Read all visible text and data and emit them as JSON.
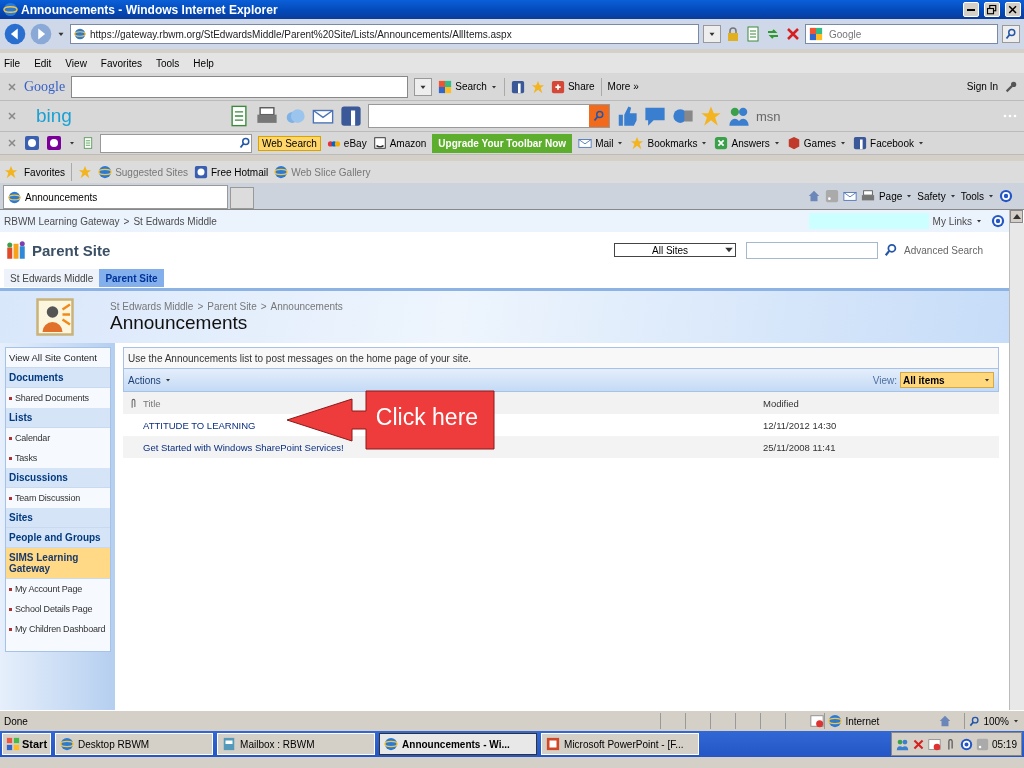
{
  "window": {
    "title": "Announcements - Windows Internet Explorer"
  },
  "address_bar": {
    "url": "https://gateway.rbwm.org/StEdwardsMiddle/Parent%20Site/Lists/Announcements/AllItems.aspx"
  },
  "search_box": {
    "placeholder": "Google"
  },
  "menu_bar": [
    "File",
    "Edit",
    "View",
    "Favorites",
    "Tools",
    "Help"
  ],
  "google_toolbar": {
    "logo": "Google",
    "search_label": "Search",
    "share_label": "Share",
    "more_label": "More »",
    "sign_in": "Sign In"
  },
  "bing_toolbar": {
    "logo": "bing",
    "msn_label": "msn"
  },
  "yahoo_toolbar": {
    "web_search": "Web Search",
    "links": [
      "eBay",
      "Amazon"
    ],
    "upgrade_button": "Upgrade Your Toolbar Now",
    "menus": [
      "Mail",
      "Bookmarks",
      "Answers",
      "Games",
      "Facebook"
    ]
  },
  "favorites_bar": {
    "label": "Favorites",
    "items": [
      "Suggested Sites",
      "Free Hotmail",
      "Web Slice Gallery"
    ]
  },
  "tabs": [
    {
      "label": "Announcements",
      "selected": true
    }
  ],
  "command_bar": [
    "Page",
    "Safety",
    "Tools"
  ],
  "page": {
    "top_breadcrumb": [
      "RBWM Learning Gateway",
      "St Edwards Middle"
    ],
    "breadcrumb_separator": ">",
    "my_links": "My Links",
    "site_title": "Parent Site",
    "search_scope": "All Sites",
    "advanced_search": "Advanced Search",
    "site_tabs": [
      {
        "label": "St Edwards Middle",
        "selected": false
      },
      {
        "label": "Parent Site",
        "selected": true
      }
    ],
    "breadcrumb": [
      "St Edwards Middle",
      "Parent Site",
      "Announcements"
    ],
    "heading": "Announcements",
    "description": "Use the Announcements list to post messages on the home page of your site.",
    "actions": "Actions",
    "view_label": "View:",
    "view": "All items",
    "columns": [
      "Title",
      "Modified"
    ],
    "rows": [
      {
        "title": "ATTITUDE TO LEARNING",
        "modified": "12/11/2012 14:30"
      },
      {
        "title": "Get Started with Windows SharePoint Services!",
        "modified": "25/11/2008 11:41"
      }
    ],
    "sidebar": [
      {
        "kind": "link",
        "label": "View All Site Content",
        "selected": false
      },
      {
        "kind": "heading",
        "label": "Documents",
        "selected": false
      },
      {
        "kind": "item",
        "label": "Shared Documents",
        "selected": false
      },
      {
        "kind": "heading",
        "label": "Lists",
        "selected": false
      },
      {
        "kind": "item",
        "label": "Calendar",
        "selected": false
      },
      {
        "kind": "item",
        "label": "Tasks",
        "selected": false
      },
      {
        "kind": "heading",
        "label": "Discussions",
        "selected": false
      },
      {
        "kind": "item",
        "label": "Team Discussion",
        "selected": false
      },
      {
        "kind": "heading",
        "label": "Sites",
        "selected": false
      },
      {
        "kind": "heading",
        "label": "People and Groups",
        "selected": false
      },
      {
        "kind": "heading",
        "label": "SIMS Learning Gateway",
        "selected": true
      },
      {
        "kind": "item",
        "label": "My Account Page",
        "selected": false
      },
      {
        "kind": "item",
        "label": "School Details Page",
        "selected": false
      },
      {
        "kind": "item",
        "label": "My Children Dashboard",
        "selected": false
      }
    ]
  },
  "callout": {
    "label": "Click here"
  },
  "status_bar": {
    "text": "Done",
    "zone": "Internet",
    "zoom": "100%"
  },
  "taskbar": {
    "start": "Start",
    "buttons": [
      {
        "label": "Desktop  RBWM",
        "selected": false
      },
      {
        "label": "Mailbox : RBWM",
        "selected": false
      },
      {
        "label": "Announcements - Wi...",
        "selected": true
      },
      {
        "label": "Microsoft PowerPoint - [F...",
        "selected": false
      }
    ],
    "clock": "05:19"
  }
}
